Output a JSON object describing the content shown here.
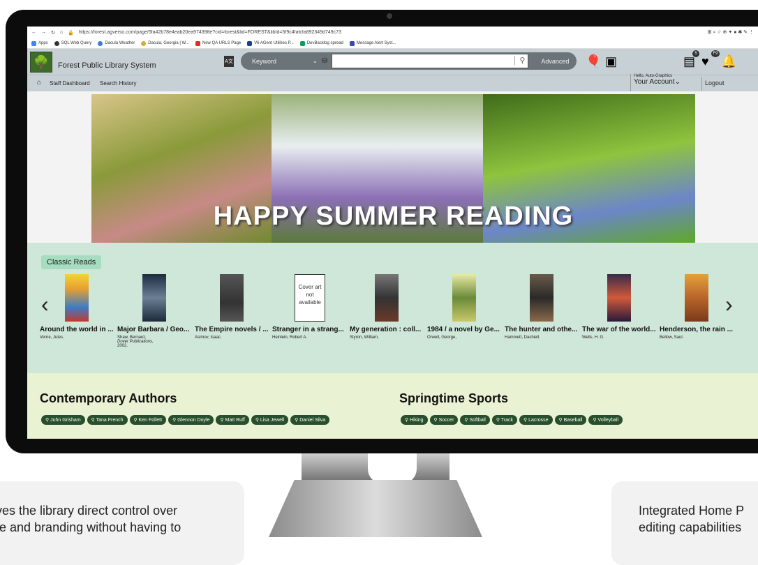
{
  "browser": {
    "url": "https://forest.agverso.com/page/5fa42b78e4eab20ea974398e?cid=forest&lid=FOREST&libId=5f9c4fafcfa892349d749c73",
    "bookmarks": [
      "Apps",
      "SQL Web Query",
      "Dacula Weather",
      "Dacula, Georgia | W...",
      "New QA URLS Page",
      "V6 AGent Utilities P...",
      "DevBacklog spread",
      "Message Alert Syst..."
    ]
  },
  "header": {
    "library_name": "Forest Public Library System",
    "search_type": "Keyword",
    "advanced_label": "Advanced",
    "list_badge": "5",
    "favorites_badge": "F9"
  },
  "nav": {
    "staff_dashboard": "Staff Dashboard",
    "search_history": "Search History",
    "hello": "Hello, Auto-Graphics",
    "your_account": "Your Account",
    "logout": "Logout"
  },
  "banner": {
    "text": "HAPPY SUMMER READING"
  },
  "classic": {
    "label": "Classic Reads",
    "no_cover": [
      "Cover art",
      "not",
      "available"
    ],
    "books": [
      {
        "title": "Around the world in ...",
        "author": "Verne, Jules.",
        "pub": "",
        "year": ""
      },
      {
        "title": "Major Barbara / Geo...",
        "author": "Shaw, Bernard,",
        "pub": "Dover Publications,",
        "year": "2002."
      },
      {
        "title": "The Empire novels / ...",
        "author": "Asimov, Isaac.",
        "pub": "",
        "year": ""
      },
      {
        "title": "Stranger in a strang...",
        "author": "Heinlein, Robert A.",
        "pub": "",
        "year": ""
      },
      {
        "title": "My generation : coll...",
        "author": "Styron, William,",
        "pub": "",
        "year": ""
      },
      {
        "title": "1984 / a novel by Ge...",
        "author": "Orwell, George,",
        "pub": "",
        "year": ""
      },
      {
        "title": "The hunter and othe...",
        "author": "Hammett, Dashiell.",
        "pub": "",
        "year": ""
      },
      {
        "title": "The war of the world...",
        "author": "Wells, H. G.",
        "pub": "",
        "year": ""
      },
      {
        "title": "Henderson, the rain ...",
        "author": "Bellow, Saul.",
        "pub": "",
        "year": ""
      }
    ]
  },
  "contemporary": {
    "title": "Contemporary Authors",
    "chips": [
      "John Grisham",
      "Tana French",
      "Ken Follett",
      "Glennon Doyle",
      "Matt Ruff",
      "Lisa Jewell",
      "Daniel Silva"
    ]
  },
  "sports": {
    "title": "Springtime Sports",
    "chips": [
      "Hiking",
      "Soccer",
      "Softball",
      "Track",
      "Lacrosse",
      "Baseball",
      "Volleyball"
    ]
  },
  "captions": {
    "left": [
      "gives the library direct control over",
      "ace and branding without having to"
    ],
    "right": [
      "Integrated Home P",
      "editing capabilities"
    ]
  }
}
